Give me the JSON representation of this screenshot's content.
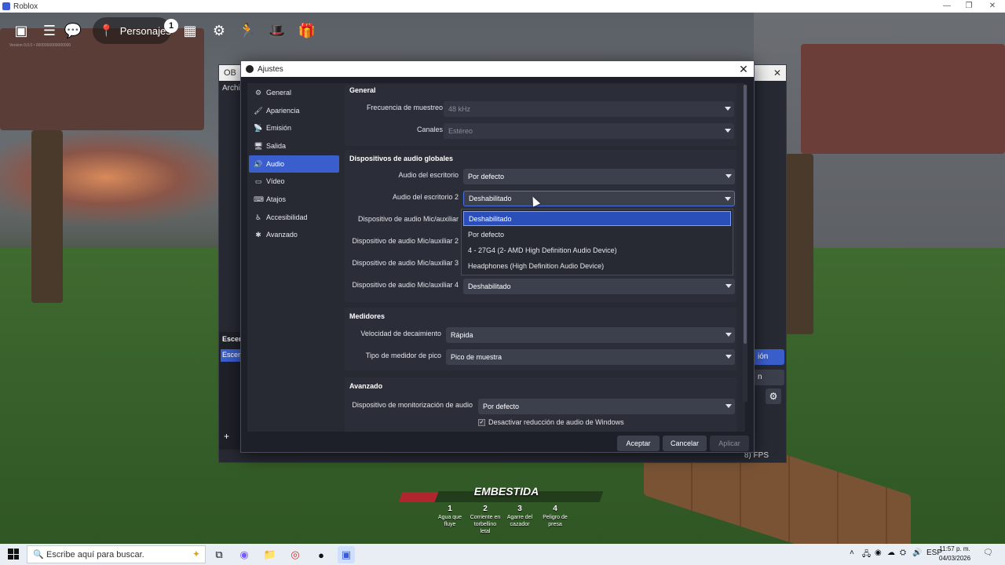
{
  "window": {
    "title": "Roblox",
    "minimize": "—",
    "maximize": "❐",
    "close": "✕"
  },
  "hud": {
    "personajes_label": "Personajes",
    "personajes_badge": "1",
    "version_text": "Version 0.0.0 • 0000000000000000"
  },
  "game": {
    "ability_title": "EMBESTIDA",
    "abilities": [
      {
        "num": "1",
        "label": "Agua que fluye"
      },
      {
        "num": "2",
        "label": "Corriente en torbellino letal"
      },
      {
        "num": "3",
        "label": "Agarre del cazador"
      },
      {
        "num": "4",
        "label": "Peligro de presa"
      }
    ]
  },
  "obs_main": {
    "title_letters": "OB",
    "menu_first": "Archi",
    "fps_text": "8) FPS",
    "side_label_1": "Escen",
    "side_label_2": "Escen",
    "right_btn_1": "ión",
    "right_btn_2": "n"
  },
  "dialog": {
    "title": "Ajustes",
    "close": "✕",
    "nav": [
      {
        "label": "General",
        "icon": "gear-icon",
        "glyph": "⚙",
        "active": false
      },
      {
        "label": "Apariencia",
        "icon": "paint-icon",
        "glyph": "🖌",
        "active": false
      },
      {
        "label": "Emisión",
        "icon": "broadcast-icon",
        "glyph": "📡",
        "active": false
      },
      {
        "label": "Salida",
        "icon": "output-icon",
        "glyph": "🖥",
        "active": false
      },
      {
        "label": "Audio",
        "icon": "speaker-icon",
        "glyph": "🔊",
        "active": true
      },
      {
        "label": "Vídeo",
        "icon": "monitor-icon",
        "glyph": "▭",
        "active": false
      },
      {
        "label": "Atajos",
        "icon": "keyboard-icon",
        "glyph": "⌨",
        "active": false
      },
      {
        "label": "Accesibilidad",
        "icon": "accessibility-icon",
        "glyph": "♿",
        "active": false
      },
      {
        "label": "Avanzado",
        "icon": "tools-icon",
        "glyph": "✱",
        "active": false
      }
    ],
    "general": {
      "title": "General",
      "sample_rate_label": "Frecuencia de muestreo",
      "sample_rate_value": "48 kHz",
      "channels_label": "Canales",
      "channels_value": "Estéreo"
    },
    "global_devices": {
      "title": "Dispositivos de audio globales",
      "desktop_label": "Audio del escritorio",
      "desktop_value": "Por defecto",
      "desktop2_label": "Audio del escritorio 2",
      "desktop2_value": "Deshabilitado",
      "mic1_label": "Dispositivo de audio Mic/auxiliar",
      "mic2_label": "Dispositivo de audio Mic/auxiliar 2",
      "mic3_label": "Dispositivo de audio Mic/auxiliar 3",
      "mic4_label": "Dispositivo de audio Mic/auxiliar 4",
      "mic4_value": "Deshabilitado"
    },
    "dropdown_options": [
      "Deshabilitado",
      "Por defecto",
      "4 - 27G4 (2- AMD High Definition Audio Device)",
      "Headphones (High Definition Audio Device)"
    ],
    "meters": {
      "title": "Medidores",
      "decay_label": "Velocidad de decaimiento",
      "decay_value": "Rápida",
      "peak_label": "Tipo de medidor de pico",
      "peak_value": "Pico de muestra"
    },
    "advanced": {
      "title": "Avanzado",
      "monitor_label": "Dispositivo de monitorización de audio",
      "monitor_value": "Por defecto",
      "ducking_label": "Desactivar reducción de audio de Windows",
      "ducking_checked": true
    },
    "buttons": {
      "accept": "Aceptar",
      "cancel": "Cancelar",
      "apply": "Aplicar"
    }
  },
  "taskbar": {
    "search_placeholder": "Escribe aquí para buscar.",
    "language": "ESP",
    "time": "11:57 p. m.",
    "date": "04/03/2026"
  }
}
